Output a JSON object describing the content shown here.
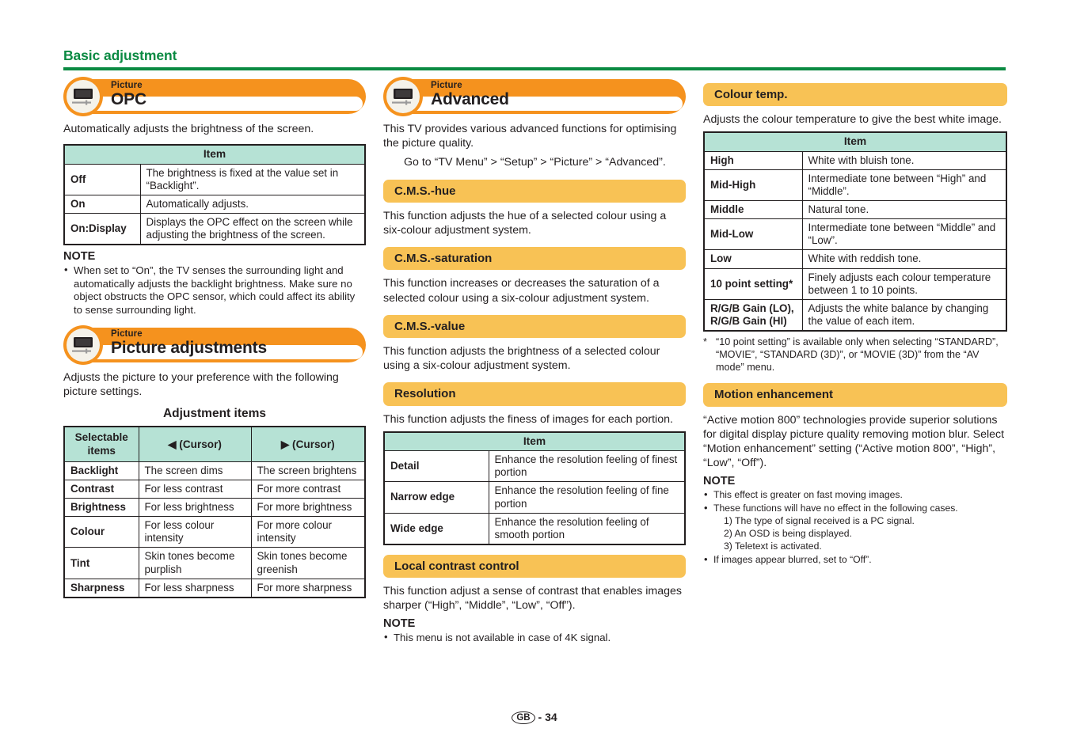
{
  "runhead": {
    "title": "Basic adjustment"
  },
  "footer": {
    "locale": "GB",
    "sep": "-",
    "page": "34"
  },
  "col1": {
    "opc": {
      "kicker": "Picture",
      "title": "OPC",
      "intro": "Automatically adjusts the brightness of the screen.",
      "table": {
        "header": "Item",
        "rows": [
          {
            "key": "Off",
            "desc": "The brightness is fixed at the value set in “Backlight”."
          },
          {
            "key": "On",
            "desc": "Automatically adjusts."
          },
          {
            "key": "On:Display",
            "desc": "Displays the OPC effect on the screen while adjusting the brightness of the screen."
          }
        ]
      },
      "note_title": "NOTE",
      "notes": [
        "When set to “On”, the TV senses the surrounding light and automatically adjusts the backlight brightness. Make sure no object obstructs the OPC sensor, which could affect its ability to sense surrounding light."
      ]
    },
    "picture_adjustments": {
      "kicker": "Picture",
      "title": "Picture adjustments",
      "intro": "Adjusts the picture to your preference with the following picture settings.",
      "sub_title": "Adjustment items",
      "table": {
        "columns": [
          "Selectable items",
          "◀ (Cursor)",
          "▶ (Cursor)"
        ],
        "rows": [
          {
            "key": "Backlight",
            "left": "The screen dims",
            "right": "The screen brightens"
          },
          {
            "key": "Contrast",
            "left": "For less contrast",
            "right": "For more contrast"
          },
          {
            "key": "Brightness",
            "left": "For less brightness",
            "right": "For more brightness"
          },
          {
            "key": "Colour",
            "left": "For less colour intensity",
            "right": "For more colour intensity"
          },
          {
            "key": "Tint",
            "left": "Skin tones become purplish",
            "right": "Skin tones become greenish"
          },
          {
            "key": "Sharpness",
            "left": "For less sharpness",
            "right": "For more sharpness"
          }
        ]
      }
    }
  },
  "col2": {
    "advanced": {
      "kicker": "Picture",
      "title": "Advanced",
      "intro": "This TV provides various advanced functions for optimising the picture quality.",
      "path": "Go to “TV Menu” > “Setup” > “Picture” > “Advanced”."
    },
    "cms_hue": {
      "heading": "C.M.S.-hue",
      "body": "This function adjusts the hue of a selected colour using a six-colour adjustment system."
    },
    "cms_saturation": {
      "heading": "C.M.S.-saturation",
      "body": "This function increases or decreases the saturation of a selected colour using a six-colour adjustment system."
    },
    "cms_value": {
      "heading": "C.M.S.-value",
      "body": "This function adjusts the brightness of a selected colour using a six-colour adjustment system."
    },
    "resolution": {
      "heading": "Resolution",
      "body": "This function adjusts the finess of images for each portion.",
      "table": {
        "header": "Item",
        "rows": [
          {
            "key": "Detail",
            "desc": "Enhance the resolution feeling of finest portion"
          },
          {
            "key": "Narrow edge",
            "desc": "Enhance the resolution feeling of fine portion"
          },
          {
            "key": "Wide edge",
            "desc": "Enhance the resolution feeling of smooth portion"
          }
        ]
      }
    },
    "local_contrast": {
      "heading": "Local contrast control",
      "body": "This function adjust a sense of contrast that enables images sharper (“High”, “Middle”, “Low”, “Off”).",
      "note_title": "NOTE",
      "notes": [
        "This menu is not available in case of 4K signal."
      ]
    }
  },
  "col3": {
    "colour_temp": {
      "heading": "Colour temp.",
      "body": "Adjusts the colour temperature to give the best white image.",
      "table": {
        "header": "Item",
        "rows": [
          {
            "key": "High",
            "desc": "White with bluish tone."
          },
          {
            "key": "Mid-High",
            "desc": "Intermediate tone between “High” and “Middle”."
          },
          {
            "key": "Middle",
            "desc": "Natural tone."
          },
          {
            "key": "Mid-Low",
            "desc": "Intermediate tone between “Middle” and “Low”."
          },
          {
            "key": "Low",
            "desc": "White with reddish tone."
          },
          {
            "key": "10 point setting*",
            "desc": "Finely adjusts each colour temperature between 1 to 10 points."
          },
          {
            "key": "R/G/B Gain (LO), R/G/B Gain (HI)",
            "desc": "Adjusts the white balance by changing the value of each item."
          }
        ]
      },
      "footnote_marker": "*",
      "footnote": "“10 point setting” is available only when selecting “STANDARD”, “MOVIE”, “STANDARD (3D)”, or “MOVIE (3D)” from the “AV mode” menu."
    },
    "motion_enhancement": {
      "heading": "Motion enhancement",
      "body": "“Active motion 800” technologies provide superior solutions for digital display picture quality removing motion blur. Select “Motion enhancement” setting (“Active motion 800”, “High”, “Low”, “Off”).",
      "note_title": "NOTE",
      "notes": [
        "This effect is greater on fast moving images.",
        "These functions will have no effect in the following cases."
      ],
      "sub_notes": [
        "1) The type of signal received is a PC signal.",
        "2) An OSD is being displayed.",
        "3) Teletext is activated."
      ],
      "notes_tail": [
        "If images appear blurred, set to “Off”."
      ]
    }
  },
  "colors": {
    "green": "#0a8a42",
    "orange": "#f5921e",
    "amber": "#f8c255",
    "teal": "#b6e2d5",
    "ink": "#231f20"
  }
}
